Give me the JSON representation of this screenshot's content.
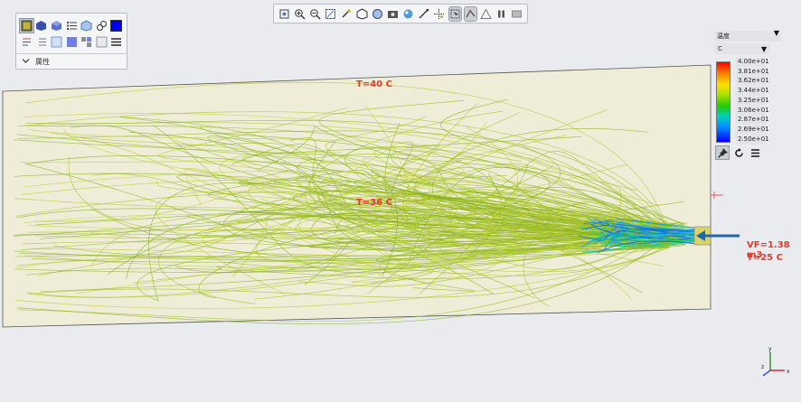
{
  "toolbar": {
    "icons": [
      "zoom-fit-icon",
      "zoom-in-icon",
      "zoom-out-icon",
      "zoom-box-icon",
      "rotate-icon",
      "view-cube-icon",
      "view-orient-icon",
      "screenshot-icon",
      "render-icon",
      "section-icon",
      "select-icon",
      "probe-icon",
      "ruler-icon",
      "animation-icon",
      "pause-icon",
      "skip-icon"
    ]
  },
  "palette": {
    "property_label": "属性"
  },
  "legend": {
    "title": "温度",
    "unit": "C",
    "ticks": [
      "4.00e+01",
      "3.81e+01",
      "3.62e+01",
      "3.44e+01",
      "3.25e+01",
      "3.06e+01",
      "2.87e+01",
      "2.69e+01",
      "2.50e+01"
    ],
    "colors": {
      "max": "#ff0000",
      "min": "#0000ff"
    }
  },
  "annotations": {
    "top_temp": "T=40 C",
    "mid_temp": "T=36 C",
    "inlet_flow": "VF=1.38 m3",
    "inlet_temp": "T=25 C"
  },
  "axes": {
    "y": "y",
    "z": "z",
    "x": "x"
  }
}
